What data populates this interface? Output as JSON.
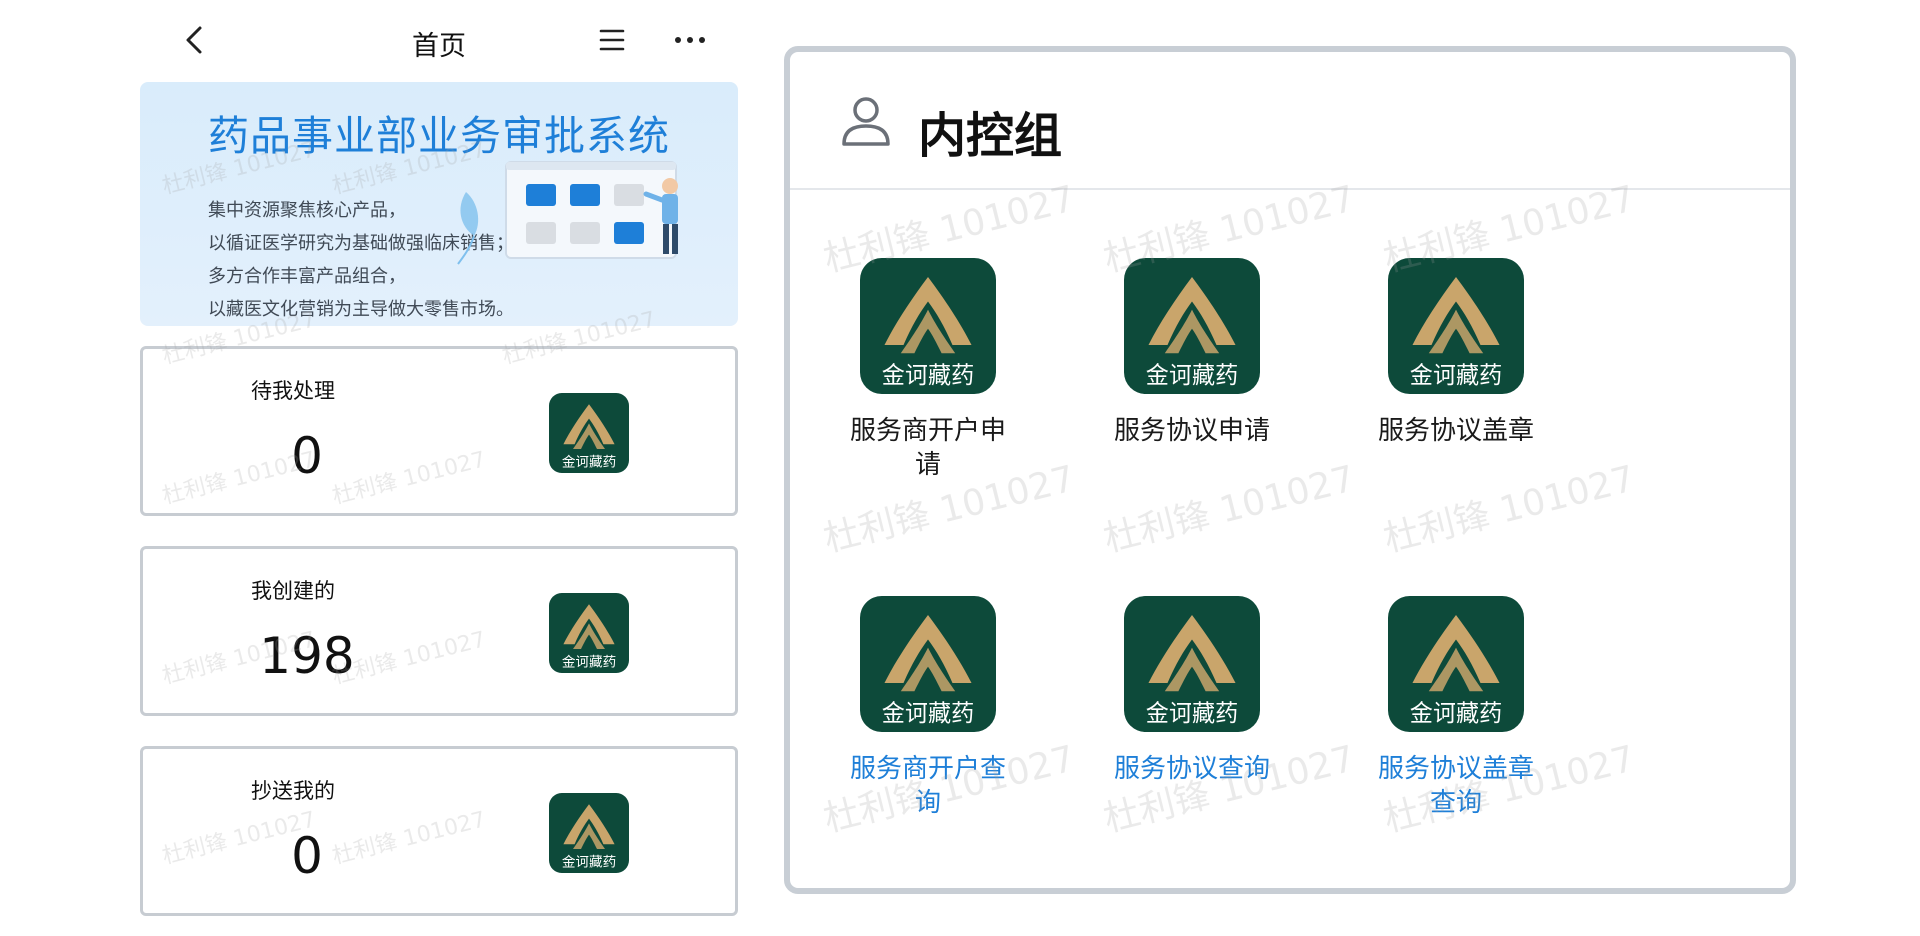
{
  "topbar": {
    "title": "首页",
    "icons": {
      "back": "chevron-left-icon",
      "menu": "hamburger-menu-icon",
      "more": "more-dots-icon"
    }
  },
  "banner": {
    "title": "药品事业部业务审批系统",
    "lines": [
      "集中资源聚焦核心产品，",
      "以循证医学研究为基础做强临床销售；",
      "多方合作丰富产品组合，",
      "以藏医文化营销为主导做大零售市场。"
    ]
  },
  "brand": {
    "logo_text": "金诃藏药",
    "logo_bg": "#0d4a3a",
    "logo_gold": "#c9a56b"
  },
  "stats": [
    {
      "label": "待我处理",
      "value": "0"
    },
    {
      "label": "我创建的",
      "value": "198"
    },
    {
      "label": "抄送我的",
      "value": "0"
    }
  ],
  "group": {
    "title": "内控组",
    "icon": "user-icon",
    "tiles": [
      {
        "label": "服务商开户申请",
        "style": "dark"
      },
      {
        "label": "服务协议申请",
        "style": "dark"
      },
      {
        "label": "服务协议盖章",
        "style": "dark"
      },
      {
        "label": "服务商开户查询",
        "style": "blue"
      },
      {
        "label": "服务协议查询",
        "style": "blue"
      },
      {
        "label": "服务协议盖章查询",
        "style": "blue"
      }
    ]
  },
  "colors": {
    "accent_blue": "#1e7fd8",
    "card_border": "#c7ccd2"
  },
  "watermark": {
    "text": "杜利锋 101027"
  }
}
